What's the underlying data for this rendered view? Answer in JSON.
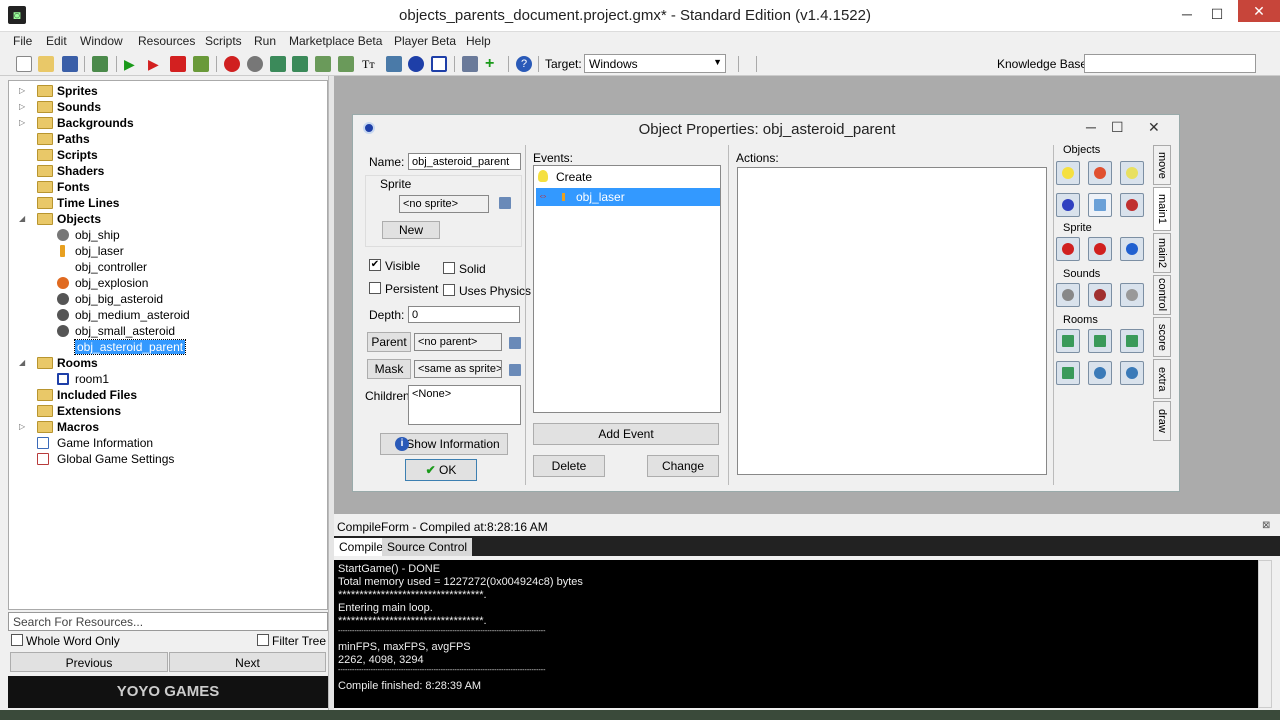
{
  "window": {
    "title": "objects_parents_document.project.gmx*  -  Standard Edition (v1.4.1522)",
    "minimize": "─",
    "maximize": "☐",
    "close": "✕"
  },
  "menu": [
    "File",
    "Edit",
    "Window",
    "Resources",
    "Scripts",
    "Run",
    "Marketplace Beta",
    "Player Beta",
    "Help"
  ],
  "toolbar": {
    "target_label": "Target:",
    "target_value": "Windows",
    "kb_label": "Knowledge Base:",
    "kb_value": ""
  },
  "tree": {
    "folders": [
      "Sprites",
      "Sounds",
      "Backgrounds",
      "Paths",
      "Scripts",
      "Shaders",
      "Fonts",
      "Time Lines",
      "Objects"
    ],
    "objects": [
      "obj_ship",
      "obj_laser",
      "obj_controller",
      "obj_explosion",
      "obj_big_asteroid",
      "obj_medium_asteroid",
      "obj_small_asteroid",
      "obj_asteroid_parent"
    ],
    "rooms_folder": "Rooms",
    "rooms": [
      "room1"
    ],
    "tail": [
      "Included Files",
      "Extensions",
      "Macros",
      "Game Information",
      "Global Game Settings"
    ]
  },
  "search": {
    "placeholder": "Search For Resources...",
    "whole_word": "Whole Word Only",
    "filter_tree": "Filter Tree",
    "previous": "Previous",
    "next": "Next"
  },
  "logo": "YOYO GAMES",
  "object_props": {
    "title": "Object Properties: obj_asteroid_parent",
    "name_label": "Name:",
    "name_value": "obj_asteroid_parent",
    "sprite_label": "Sprite",
    "sprite_value": "<no sprite>",
    "new_button": "New",
    "visible": "Visible",
    "solid": "Solid",
    "persistent": "Persistent",
    "uses_physics": "Uses Physics",
    "depth_label": "Depth:",
    "depth_value": "0",
    "parent_button": "Parent",
    "parent_value": "<no parent>",
    "mask_button": "Mask",
    "mask_value": "<same as sprite>",
    "children_label": "Children:",
    "children_value": "<None>",
    "show_info": "Show Information",
    "ok": "OK",
    "events_label": "Events:",
    "events": [
      "Create",
      "obj_laser"
    ],
    "add_event": "Add Event",
    "delete": "Delete",
    "change": "Change",
    "actions_label": "Actions:",
    "sections": {
      "objects": "Objects",
      "sprite": "Sprite",
      "sounds": "Sounds",
      "rooms": "Rooms"
    },
    "vtabs": [
      "move",
      "main1",
      "main2",
      "control",
      "score",
      "extra",
      "draw"
    ]
  },
  "compile": {
    "header": "CompileForm - Compiled at:8:28:16 AM",
    "tabs": [
      "Compile",
      "Source Control"
    ],
    "lines": [
      "StartGame() - DONE",
      "Total memory used = 1227272(0x004924c8) bytes",
      "**********************************.",
      "Entering main loop.",
      "**********************************.",
      "-----------------------------------------------------------------------------------------",
      "minFPS, maxFPS, avgFPS",
      "2262, 4098, 3294",
      "-----------------------------------------------------------------------------------------",
      "Compile finished: 8:28:39 AM"
    ]
  }
}
